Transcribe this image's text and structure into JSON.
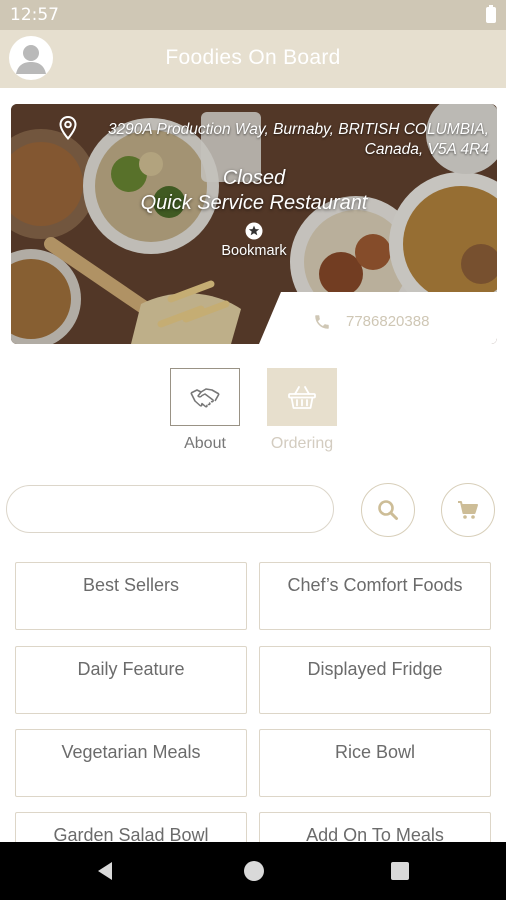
{
  "status_bar": {
    "time": "12:57"
  },
  "app_bar": {
    "title": "Foodies On Board"
  },
  "restaurant": {
    "address_line1": "3290A Production Way, Burnaby, BRITISH COLUMBIA,",
    "address_line2": "Canada, V5A 4R4",
    "open_status": "Closed",
    "type": "Quick Service Restaurant",
    "bookmark_label": "Bookmark",
    "phone": "7786820388"
  },
  "tabs": {
    "about_label": "About",
    "ordering_label": "Ordering"
  },
  "search": {
    "value": "",
    "placeholder": ""
  },
  "categories": [
    "Best Sellers",
    "Chef’s Comfort Foods",
    "Daily Feature",
    "Displayed Fridge",
    "Vegetarian Meals",
    "Rice Bowl",
    "Garden Salad Bowl",
    "Add On To Meals"
  ],
  "colors": {
    "accent": "#e6dfcf",
    "status_bar": "#cfc7b5",
    "phone_text": "#cfc7b5",
    "icon_tint": "#cdbd97"
  },
  "icons": {
    "avatar": "person-icon",
    "location": "location-pin-icon",
    "bookmark": "star-circle-icon",
    "phone": "phone-icon",
    "about": "handshake-icon",
    "ordering": "basket-icon",
    "search": "search-icon",
    "cart": "cart-icon"
  }
}
